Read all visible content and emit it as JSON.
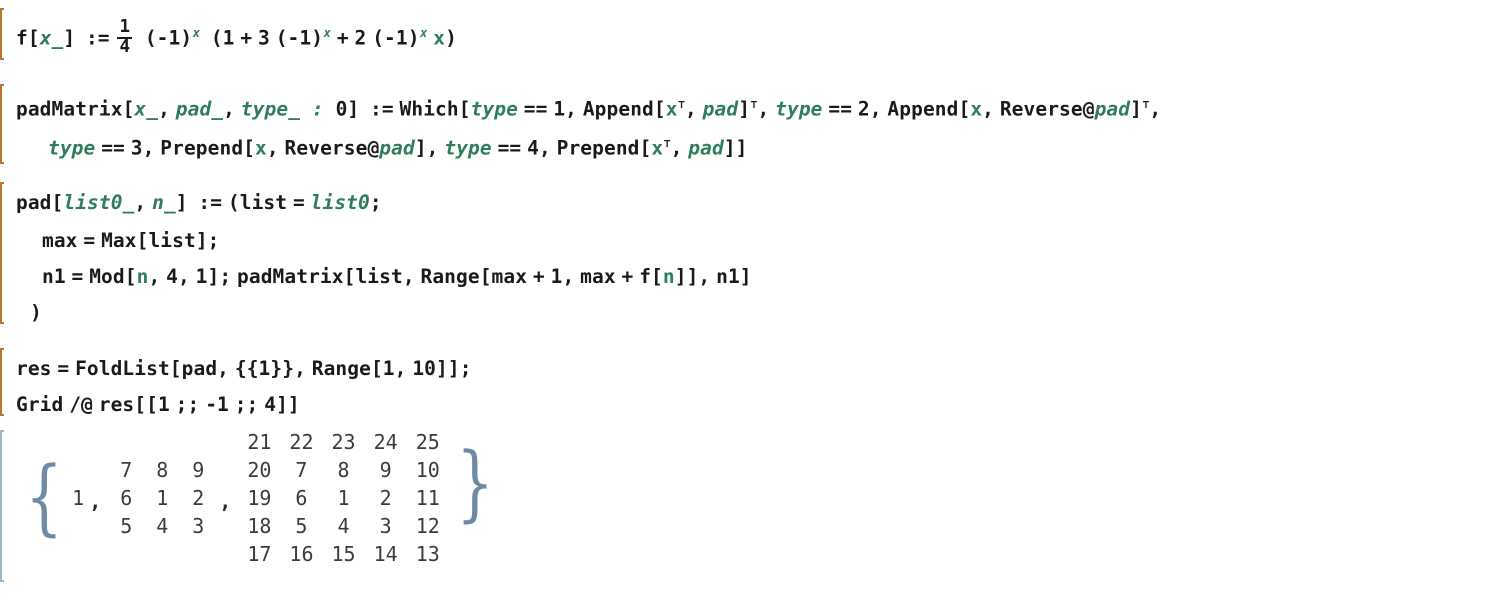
{
  "app": {
    "kind": "wolfram-mathematica-notebook",
    "background": "#ffffff",
    "colors": {
      "input_text": "#1a1a1a",
      "pattern_symbol": "#2f7d5c",
      "output_text": "#3c3c3c",
      "input_bracket": "#b9772e",
      "output_bracket": "#9ab6cc",
      "brace": "#6f8ba3"
    }
  },
  "cells": [
    {
      "type": "input",
      "id": "cell-f-definition",
      "lines": [
        "f[x_] := 1/4 (-1)^x (1 + 3 (-1)^x + 2 (-1)^x x)"
      ],
      "tokens": {
        "head": "f",
        "open_bracket": "[",
        "pattern": "x_",
        "close_bracket": "]",
        "set_delayed": ":=",
        "frac_num": "1",
        "frac_den": "4",
        "base": "(-1)",
        "exponent": "x",
        "plus": "+",
        "coeff3": "3",
        "coeff2": "2",
        "one": "1"
      }
    },
    {
      "type": "input",
      "id": "cell-padmatrix-definition",
      "lines": [
        "padMatrix[x_, pad_, type_ : 0] := Which[type == 1, Append[x⊤, pad]⊤, type == 2, Append[x, Reverse@pad]⊤,",
        "  type == 3, Prepend[x, Reverse@pad], type == 4, Prepend[x⊤, pad]]"
      ],
      "tokens": {
        "head": "padMatrix",
        "arg1": "x_",
        "arg2": "pad_",
        "arg3": "type_",
        "default": "0",
        "which": "Which",
        "append": "Append",
        "prepend": "Prepend",
        "reverse": "Reverse",
        "transpose_mark": "⊤",
        "type_symbol": "type",
        "x_symbol": "x",
        "pad_symbol": "pad",
        "eq": "==",
        "v1": "1",
        "v2": "2",
        "v3": "3",
        "v4": "4"
      }
    },
    {
      "type": "input",
      "id": "cell-pad-definition",
      "lines": [
        "pad[list0_, n_] := (list = list0;",
        "  max = Max[list];",
        "  n1 = Mod[n, 4, 1]; padMatrix[list, Range[max + 1, max + f[n]], n1]",
        " )"
      ],
      "tokens": {
        "head": "pad",
        "arg1": "list0_",
        "arg2": "n_",
        "list": "list",
        "list0": "list0",
        "max": "max",
        "Max": "Max",
        "n1": "n1",
        "Mod": "Mod",
        "n": "n",
        "four": "4",
        "one": "1",
        "padMatrix": "padMatrix",
        "Range": "Range",
        "f": "f"
      }
    },
    {
      "type": "input",
      "id": "cell-res-foldlist",
      "lines": [
        "res = FoldList[pad, {{1}}, Range[1, 10]];",
        "Grid /@ res[[1 ;; -1 ;; 4]]"
      ],
      "tokens": {
        "res": "res",
        "FoldList": "FoldList",
        "pad": "pad",
        "seed": "{{1}}",
        "Range": "Range",
        "range_from": "1",
        "range_to": "10",
        "Grid": "Grid",
        "map": "/@",
        "span_start": "1",
        "span_end": "-1",
        "span_step": "4",
        "span_op": ";;"
      }
    },
    {
      "type": "output",
      "id": "cell-output-grids",
      "open_brace": "{",
      "close_brace": "}",
      "separator": ",",
      "items": [
        {
          "kind": "scalar",
          "value": "1"
        },
        {
          "kind": "grid",
          "rows": [
            [
              "7",
              "8",
              "9"
            ],
            [
              "6",
              "1",
              "2"
            ],
            [
              "5",
              "4",
              "3"
            ]
          ]
        },
        {
          "kind": "grid",
          "rows": [
            [
              "21",
              "22",
              "23",
              "24",
              "25"
            ],
            [
              "20",
              "7",
              "8",
              "9",
              "10"
            ],
            [
              "19",
              "6",
              "1",
              "2",
              "11"
            ],
            [
              "18",
              "5",
              "4",
              "3",
              "12"
            ],
            [
              "17",
              "16",
              "15",
              "14",
              "13"
            ]
          ]
        }
      ]
    }
  ]
}
